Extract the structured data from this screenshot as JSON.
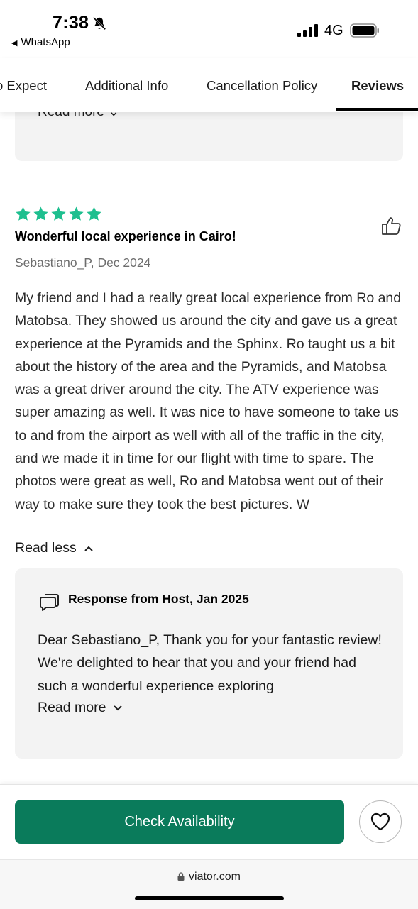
{
  "status_bar": {
    "time": "7:38",
    "back_app": "WhatsApp",
    "network": "4G"
  },
  "tabs": [
    {
      "label": "o Expect"
    },
    {
      "label": "Additional Info"
    },
    {
      "label": "Cancellation Policy"
    },
    {
      "label": "Reviews",
      "active": true
    }
  ],
  "previous_card": {
    "read_more": "Read more"
  },
  "review": {
    "rating": 5,
    "title": "Wonderful local experience in Cairo!",
    "author_date": "Sebastiano_P, Dec 2024",
    "body": "My friend and I had a really great local experience from Ro and Matobsa. They showed us around the city and gave us a great experience at the Pyramids and the Sphinx. Ro taught us a bit about the history of the area and the Pyramids, and Matobsa was a great driver around the city. The ATV experience was super amazing as well. It was nice to have someone to take us to and from the airport as well with all of the traffic in the city, and we made it in time for our flight with time to spare. The photos were great as well, Ro and Matobsa went out of their way to make sure they took the best pictures. W",
    "read_less": "Read less"
  },
  "host_response": {
    "title": "Response from Host, Jan 2025",
    "body": "Dear Sebastiano_P, Thank you for your fantastic review! We're delighted to hear that you and your friend had such a wonderful experience exploring",
    "read_more": "Read more"
  },
  "actions": {
    "check_availability": "Check Availability"
  },
  "browser": {
    "url": "viator.com"
  },
  "colors": {
    "star": "#1ebf8f",
    "primary_button": "#0a7b5b",
    "card_bg": "#f3f3f3"
  }
}
